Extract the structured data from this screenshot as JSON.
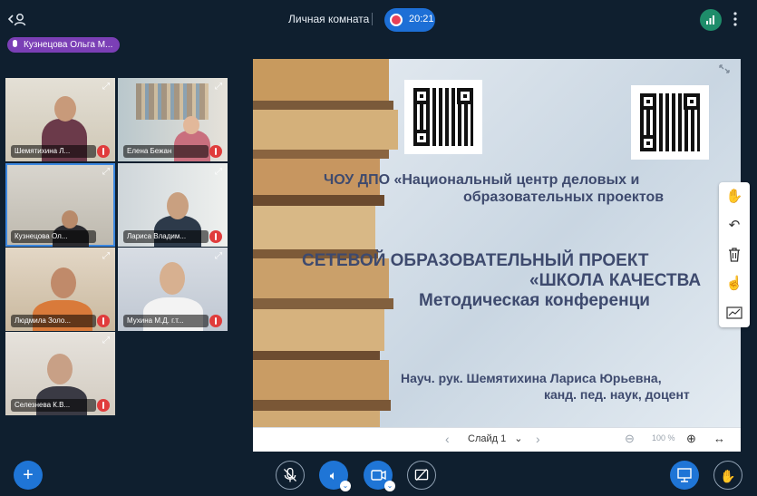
{
  "topbar": {
    "room_title": "Личная комната",
    "recording_time": "20:21",
    "more_icon": "more-vertical-icon"
  },
  "speaker": {
    "name": "Кузнецова Ольга М..."
  },
  "participants": [
    {
      "name": "Шемятихина Л...",
      "muted": true
    },
    {
      "name": "Елена Бежан",
      "muted": true
    },
    {
      "name": "Кузнецова Ол...",
      "muted": false,
      "active": true
    },
    {
      "name": "Лариса Владим...",
      "muted": true
    },
    {
      "name": "Людмила Золо...",
      "muted": true
    },
    {
      "name": "Мухина М.Д. г.т...",
      "muted": true
    },
    {
      "name": "Селезнева К.В...",
      "muted": true
    }
  ],
  "slide": {
    "org_line1": "ЧОУ ДПО «Национальный центр деловых и",
    "org_line2": "образовательных проектов",
    "project_line1": "СЕТЕВОЙ ОБРАЗОВАТЕЛЬНЫЙ ПРОЕКТ",
    "project_line2": "«ШКОЛА КАЧЕСТВА",
    "project_line3": "Методическая конференци",
    "author_line1": "Науч. рук. Шемятихина Лариса Юрьевна,",
    "author_line2": "канд. пед. наук, доцент"
  },
  "slidebar": {
    "slide_label": "Слайд 1",
    "zoom": "100 %"
  },
  "colors": {
    "background": "#0f1f2f",
    "accent": "#1f75d6",
    "speaker_pill": "#7b3fb6",
    "mute": "#e03c3c",
    "recording": "#e94057"
  }
}
